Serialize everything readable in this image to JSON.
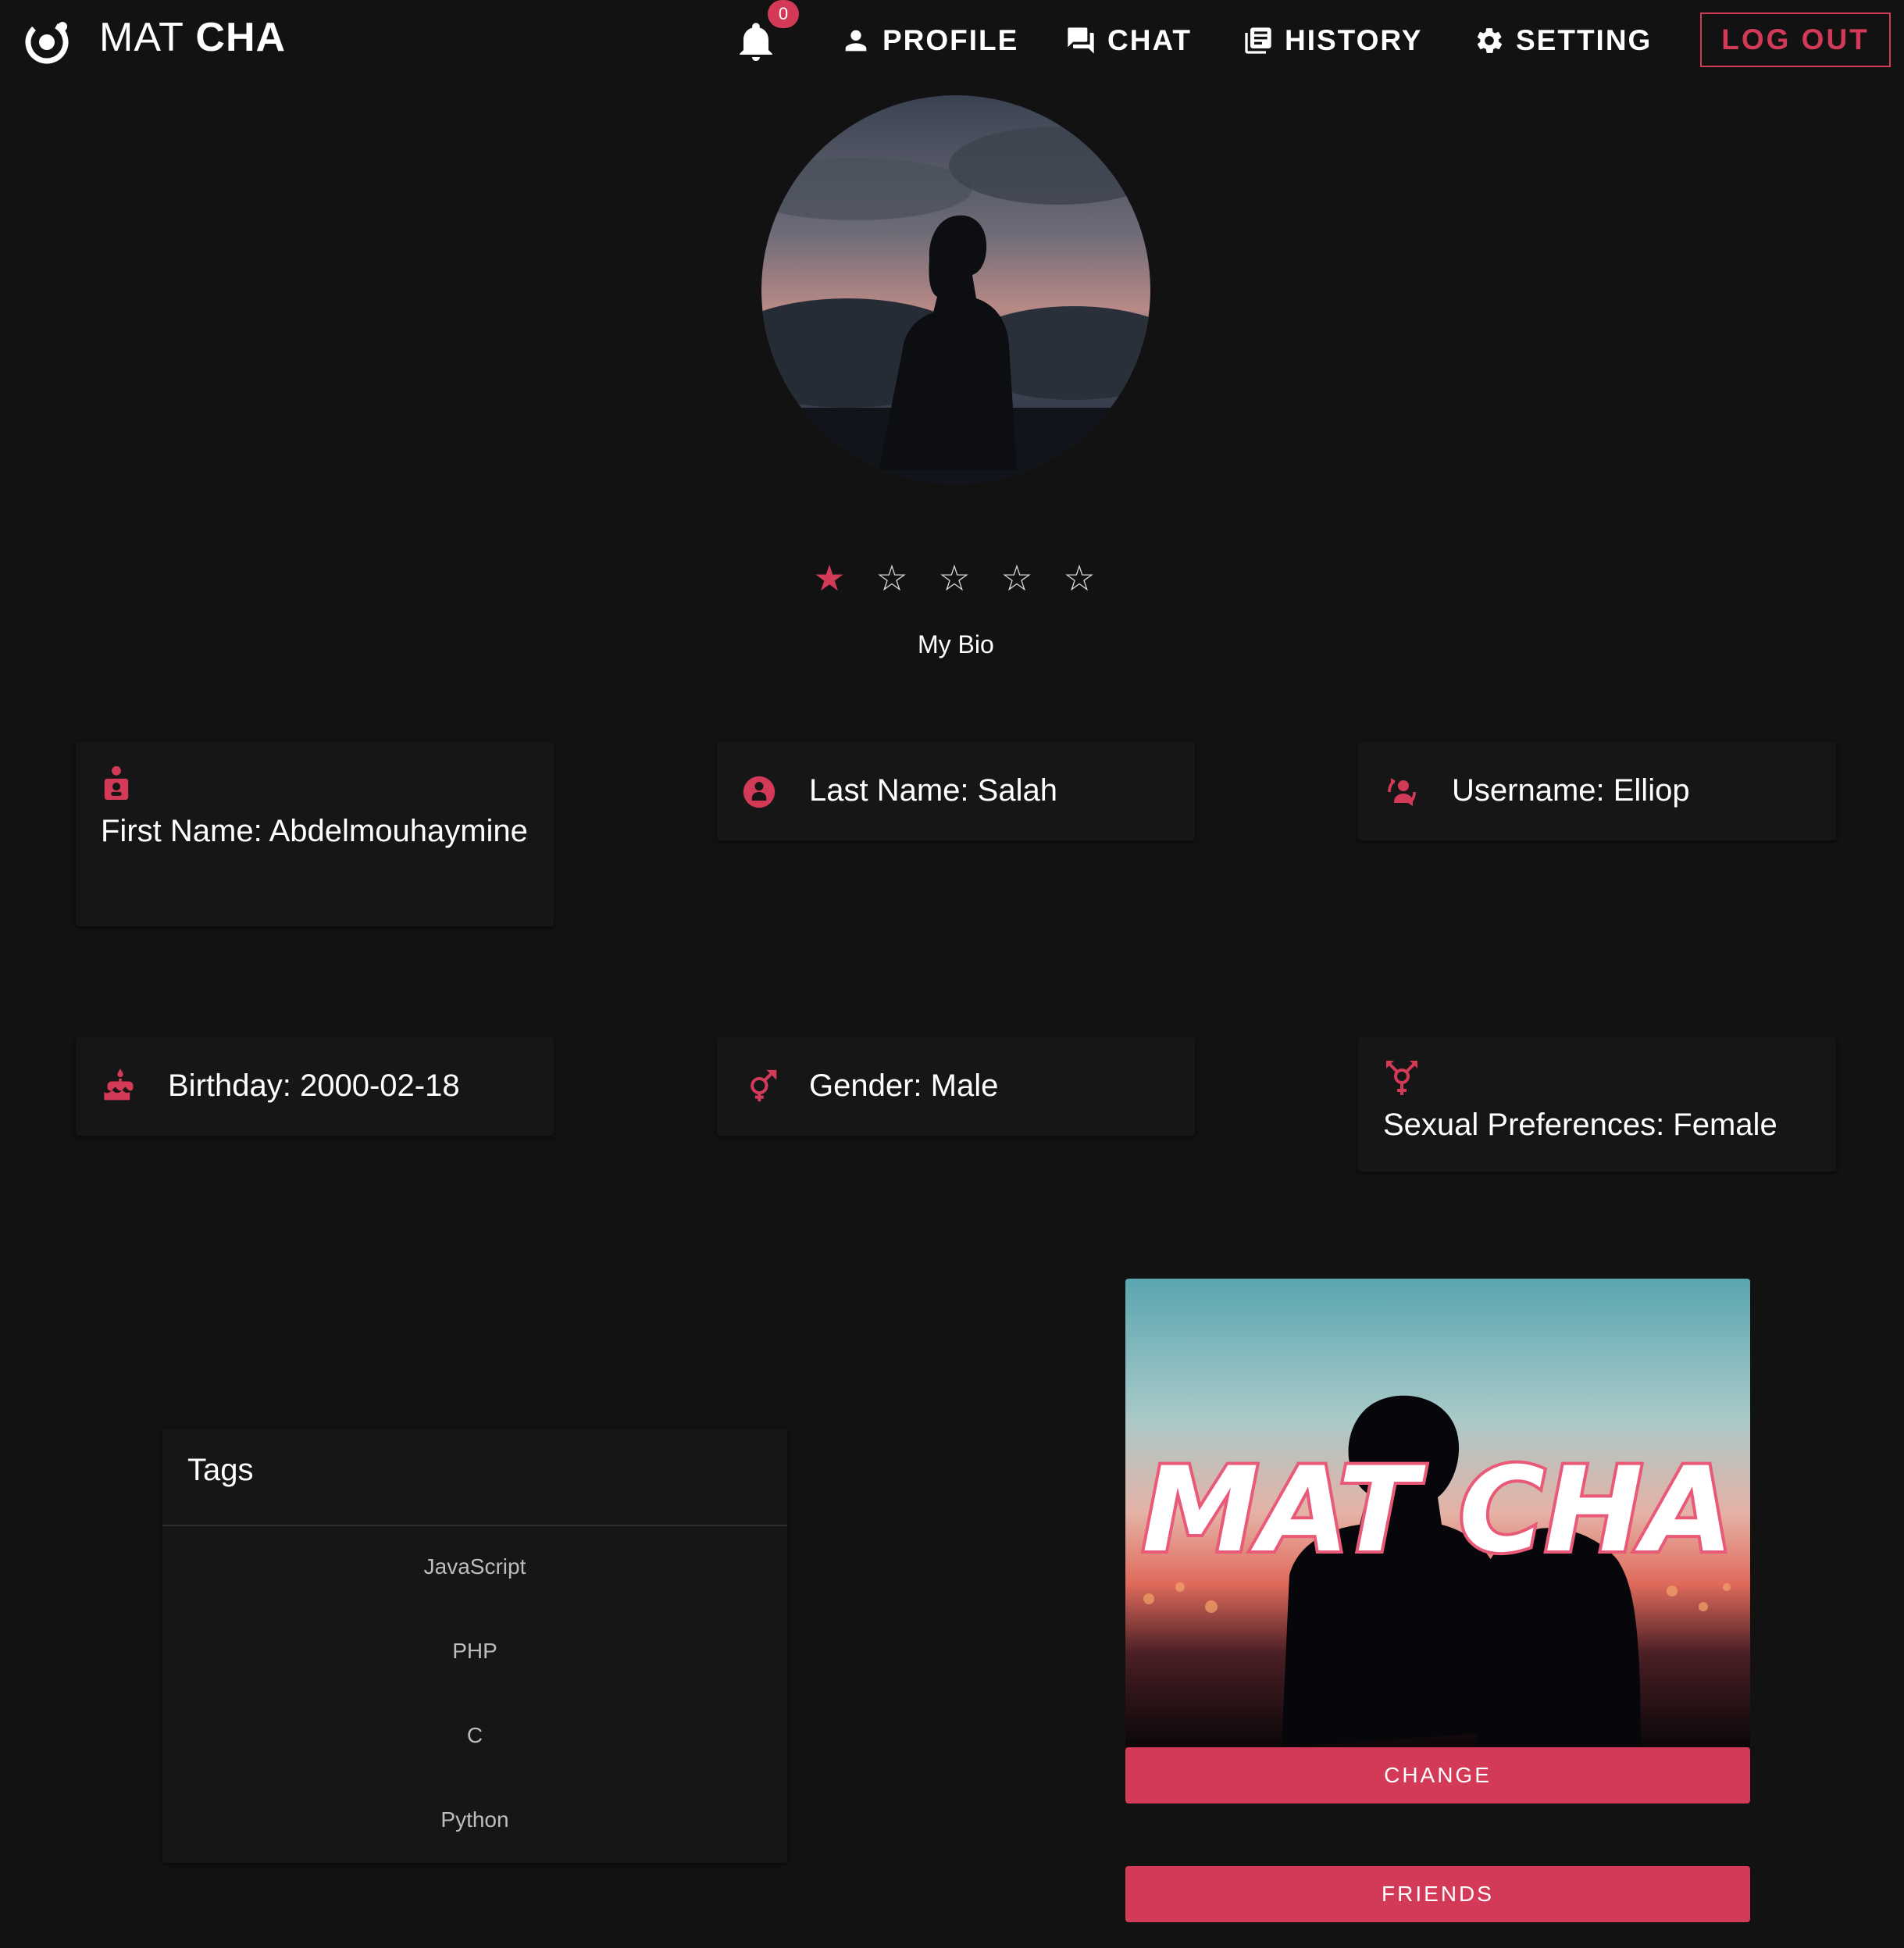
{
  "nav": {
    "brand_light": "MAT",
    "brand_bold": "CHA",
    "notification_count": "0",
    "items": [
      {
        "label": "PROFILE",
        "icon": "person-icon"
      },
      {
        "label": "CHAT",
        "icon": "chat-icon"
      },
      {
        "label": "HISTORY",
        "icon": "history-icon"
      },
      {
        "label": "SETTING",
        "icon": "gear-icon"
      }
    ],
    "logout_label": "LOG OUT"
  },
  "profile": {
    "rating": 1,
    "rating_max": 5,
    "bio": "My Bio"
  },
  "info": {
    "first_name": "First Name: Abdelmouhaymine",
    "last_name": "Last Name: Salah",
    "username": "Username: Elliop",
    "birthday": "Birthday: 2000-02-18",
    "gender": "Gender: Male",
    "sexual_preferences": "Sexual Preferences: Female"
  },
  "tags": {
    "title": "Tags",
    "items": [
      "JavaScript",
      "PHP",
      "C",
      "Python"
    ]
  },
  "cover": {
    "overlay_text": "MAT CHA",
    "change_label": "CHANGE",
    "friends_label": "FRIENDS"
  },
  "colors": {
    "accent": "#d23a57",
    "background": "#121212",
    "card": "#161616"
  }
}
